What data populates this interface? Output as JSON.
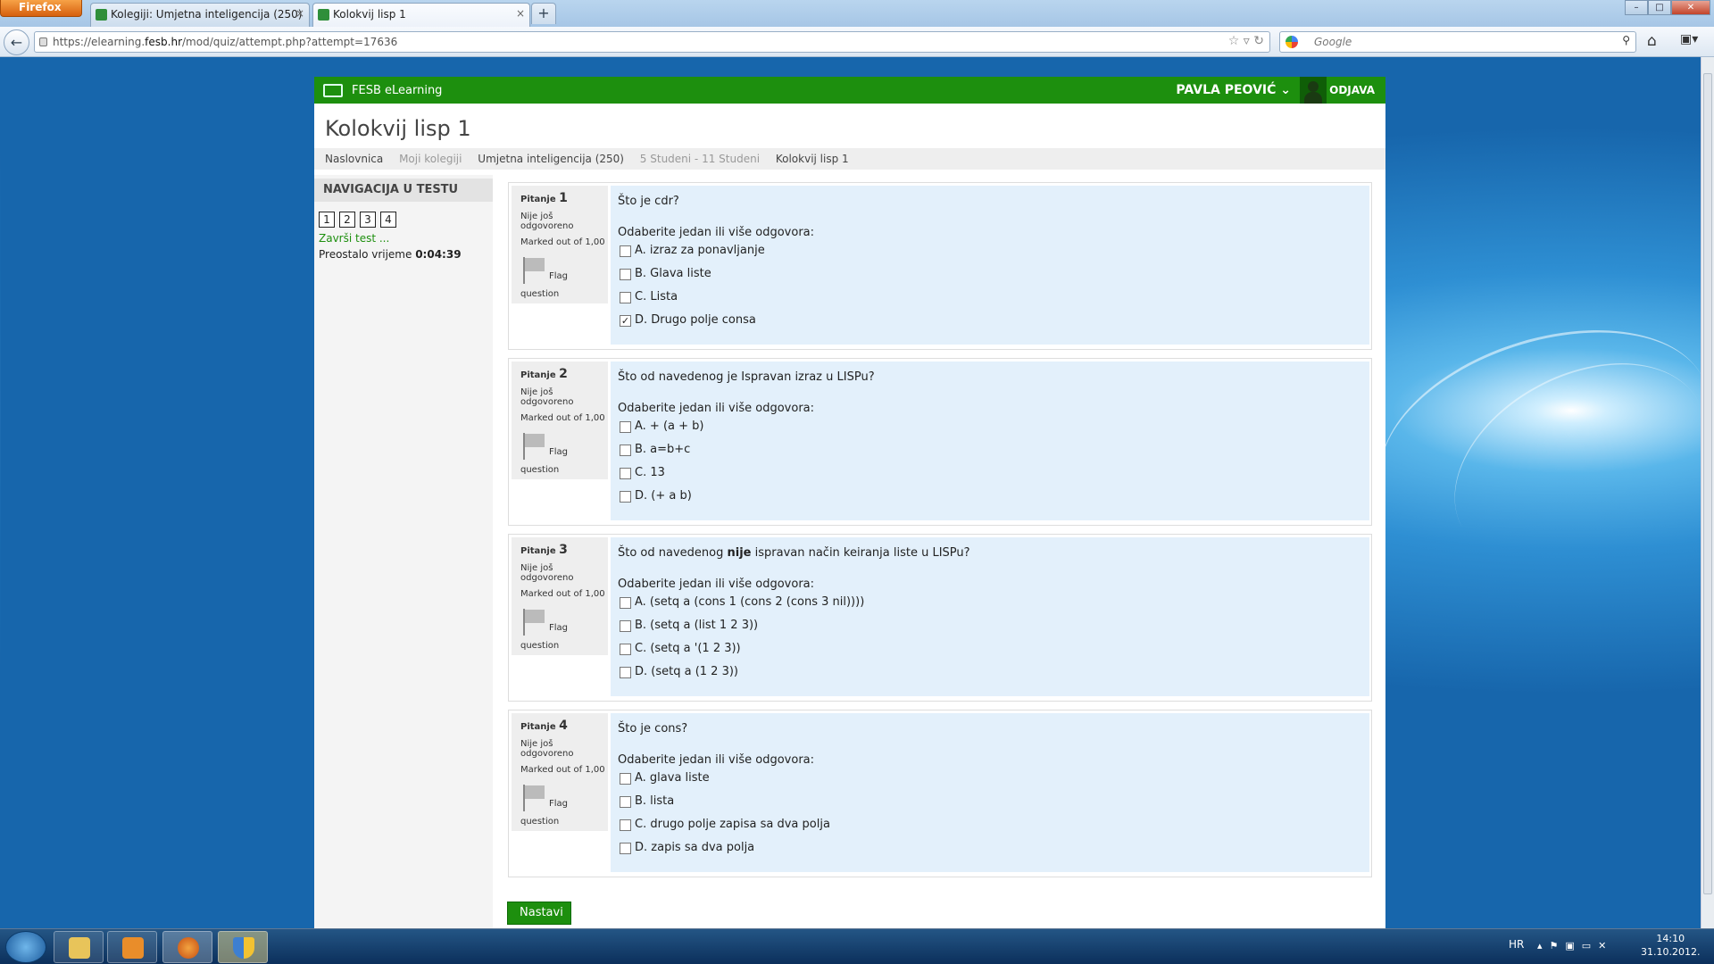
{
  "browser": {
    "menu_button": "Firefox",
    "tabs": [
      {
        "label": "Kolegiji: Umjetna inteligencija (250)"
      },
      {
        "label": "Kolokvij lisp 1"
      }
    ],
    "url_prefix": "https://elearning.",
    "url_domain": "fesb.hr",
    "url_suffix": "/mod/quiz/attempt.php?attempt=17636",
    "search_placeholder": "Google"
  },
  "site": {
    "brand": "FESB eLearning",
    "user_name": "PAVLA PEOVIĆ",
    "logout": "ODJAVA",
    "page_title": "Kolokvij lisp 1",
    "breadcrumbs": [
      {
        "label": "Naslovnica"
      },
      {
        "label": "Moji kolegiji"
      },
      {
        "label": "Umjetna inteligencija (250)"
      },
      {
        "label": "5 Studeni - 11 Studeni"
      },
      {
        "label": "Kolokvij lisp 1"
      }
    ]
  },
  "sidebar": {
    "title": "NAVIGACIJA U TESTU",
    "question_buttons": [
      "1",
      "2",
      "3",
      "4"
    ],
    "finish_link": "Završi test ...",
    "time_label": "Preostalo vrijeme ",
    "time_value": "0:04:39"
  },
  "questions": [
    {
      "label": "Pitanje ",
      "number": "1",
      "state": "Nije još odgovoreno",
      "marks": "Marked out of 1,00",
      "flag_label": "Flag",
      "flag_label2": "question",
      "text": "Što je cdr?",
      "prompt": "Odaberite jedan ili više odgovora:",
      "options": [
        {
          "text": "A. izraz za ponavljanje",
          "checked": false
        },
        {
          "text": "B. Glava liste",
          "checked": false
        },
        {
          "text": "C. Lista",
          "checked": false
        },
        {
          "text": "D. Drugo polje consa",
          "checked": true
        }
      ]
    },
    {
      "label": "Pitanje ",
      "number": "2",
      "state": "Nije još odgovoreno",
      "marks": "Marked out of 1,00",
      "flag_label": "Flag",
      "flag_label2": "question",
      "text": "Što od navedenog je Ispravan izraz u LISPu?",
      "prompt": "Odaberite jedan ili više odgovora:",
      "options": [
        {
          "text": "A. + (a + b)",
          "checked": false
        },
        {
          "text": "B. a=b+c",
          "checked": false
        },
        {
          "text": "C. 13",
          "checked": false
        },
        {
          "text": "D. (+ a b)",
          "checked": false
        }
      ]
    },
    {
      "label": "Pitanje ",
      "number": "3",
      "state": "Nije još odgovoreno",
      "marks": "Marked out of 1,00",
      "flag_label": "Flag",
      "flag_label2": "question",
      "text_before": "Što od navedenog ",
      "text_bold": "nije",
      "text_after": " ispravan način keiranja liste u LISPu?",
      "prompt": "Odaberite jedan ili više odgovora:",
      "options": [
        {
          "text": "A. (setq a (cons 1 (cons 2 (cons 3 nil))))",
          "checked": false
        },
        {
          "text": "B. (setq a (list 1 2 3))",
          "checked": false
        },
        {
          "text": "C. (setq a '(1 2 3))",
          "checked": false
        },
        {
          "text": "D. (setq a (1 2 3))",
          "checked": false
        }
      ]
    },
    {
      "label": "Pitanje ",
      "number": "4",
      "state": "Nije još odgovoreno",
      "marks": "Marked out of 1,00",
      "flag_label": "Flag",
      "flag_label2": "question",
      "text": "Što je cons?",
      "prompt": "Odaberite jedan ili više odgovora:",
      "options": [
        {
          "text": "A. glava liste",
          "checked": false
        },
        {
          "text": "B. lista",
          "checked": false
        },
        {
          "text": "C. drugo polje zapisa sa dva polja",
          "checked": false
        },
        {
          "text": "D. zapis sa dva polja",
          "checked": false
        }
      ]
    }
  ],
  "next_button": "Nastavi",
  "taskbar": {
    "language": "HR",
    "time": "14:10",
    "date": "31.10.2012."
  },
  "colors": {
    "brand_green": "#1d8f0e",
    "question_bg": "#e3f0fb"
  }
}
